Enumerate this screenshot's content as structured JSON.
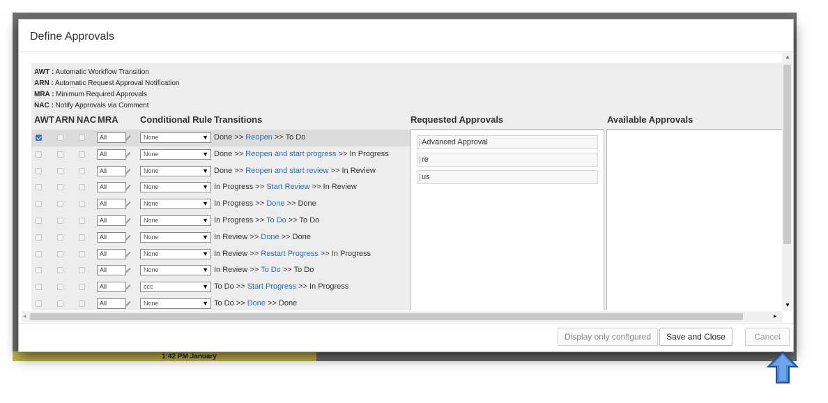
{
  "dialog": {
    "title": "Define Approvals"
  },
  "legend": [
    {
      "abbr": "AWT :",
      "text": " Automatic Workflow Transition"
    },
    {
      "abbr": "ARN :",
      "text": " Automatic Request Approval Notification"
    },
    {
      "abbr": "MRA :",
      "text": " Minimum Required Approvals"
    },
    {
      "abbr": "NAC :",
      "text": " Notify Approvals via Comment"
    }
  ],
  "headers": {
    "awt": "AWT",
    "arn": "ARN",
    "nac": "NAC",
    "mra": "MRA",
    "rule": "Conditional Rule",
    "transitions": "Transitions",
    "requested": "Requested Approvals",
    "available": "Available Approvals"
  },
  "rows": [
    {
      "awt": true,
      "arn": false,
      "nac": false,
      "mra": "All",
      "rule": "None",
      "from": "Done >> ",
      "action": "Reopen",
      "to": " >> To Do",
      "selected": true
    },
    {
      "awt": false,
      "arn": false,
      "nac": false,
      "mra": "All",
      "rule": "None",
      "from": "Done >> ",
      "action": "Reopen and start progress",
      "to": " >> In Progress",
      "selected": false
    },
    {
      "awt": false,
      "arn": false,
      "nac": false,
      "mra": "All",
      "rule": "None",
      "from": "Done >> ",
      "action": "Reopen and start review",
      "to": " >> In Review",
      "selected": false
    },
    {
      "awt": false,
      "arn": false,
      "nac": false,
      "mra": "All",
      "rule": "None",
      "from": "In Progress >> ",
      "action": "Start Review",
      "to": " >> In Review",
      "selected": false
    },
    {
      "awt": false,
      "arn": false,
      "nac": false,
      "mra": "All",
      "rule": "None",
      "from": "In Progress >> ",
      "action": "Done",
      "to": " >> Done",
      "selected": false
    },
    {
      "awt": false,
      "arn": false,
      "nac": false,
      "mra": "All",
      "rule": "None",
      "from": "In Progress >> ",
      "action": "To Do",
      "to": " >> To Do",
      "selected": false
    },
    {
      "awt": false,
      "arn": false,
      "nac": false,
      "mra": "All",
      "rule": "None",
      "from": "In Review >> ",
      "action": "Done",
      "to": " >> Done",
      "selected": false
    },
    {
      "awt": false,
      "arn": false,
      "nac": false,
      "mra": "All",
      "rule": "None",
      "from": "In Review >> ",
      "action": "Restart Progress",
      "to": " >> In Progress",
      "selected": false
    },
    {
      "awt": false,
      "arn": false,
      "nac": false,
      "mra": "All",
      "rule": "None",
      "from": "In Review >> ",
      "action": "To Do",
      "to": " >> To Do",
      "selected": false
    },
    {
      "awt": false,
      "arn": false,
      "nac": false,
      "mra": "All",
      "rule": "ccc",
      "from": "To Do >> ",
      "action": "Start Progress",
      "to": " >> In Progress",
      "selected": false
    },
    {
      "awt": false,
      "arn": false,
      "nac": false,
      "mra": "All",
      "rule": "None",
      "from": "To Do >> ",
      "action": "Done",
      "to": " >> Done",
      "selected": false
    }
  ],
  "requested_approvals": [
    "Advanced Approval",
    "re",
    "us"
  ],
  "footer": {
    "display_only_configured": "Display only configured",
    "save_and_close": "Save and Close",
    "cancel": "Cancel"
  },
  "background": {
    "taskbar_text": "1:42 PM   January"
  },
  "colors": {
    "link": "#2a6ebb",
    "checked": "#3b6fc2",
    "annotation_arrow": "#4a86d8"
  }
}
